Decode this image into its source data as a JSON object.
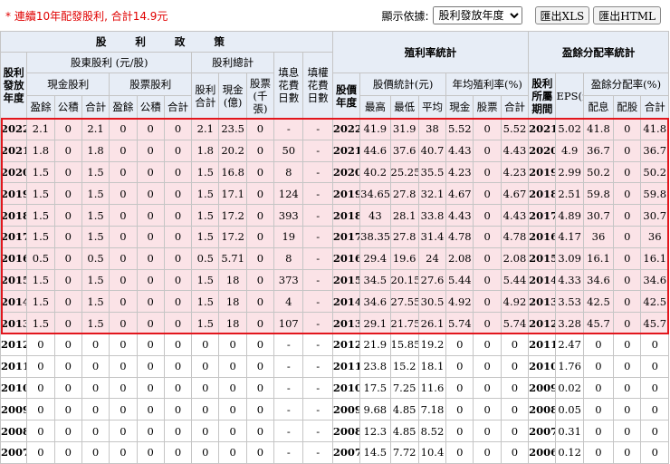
{
  "notice": "* 連續10年配發股利, 合計14.9元",
  "controls": {
    "filter_label": "顯示依據:",
    "filter_value": "股利發放年度",
    "export_xls": "匯出XLS",
    "export_html": "匯出HTML"
  },
  "headers": {
    "dividend_policy": "股 利 政 策",
    "dividend_year": "股利發放年度",
    "shareholder_dividend": "股東股利 (元/股)",
    "total_dividend": "股利總計",
    "ex_div_days": "填息花費日數",
    "ex_right_days": "填權花費日數",
    "cash_dividend": "現金股利",
    "stock_dividend": "股票股利",
    "dividend_total": "股利合計",
    "cash_100m": "現金(億)",
    "stock_k": "股票(千張)",
    "earnings": "盈餘",
    "capital_reserve": "公積",
    "subtotal": "合計",
    "yield_stats": "殖利率統計",
    "stock_year": "股價年度",
    "price_stats": "股價統計(元)",
    "avg_yield": "年均殖利率(%)",
    "high": "最高",
    "low": "最低",
    "avg": "平均",
    "cash": "現金",
    "stock": "股票",
    "payout_stats": "盈餘分配率統計",
    "earnings_period": "股利所屬期間",
    "eps": "EPS(元)",
    "payout_ratio": "盈餘分配率(%)",
    "pay_cash": "配息",
    "pay_stock": "配股"
  },
  "rows": [
    [
      "2022",
      "2.1",
      "0",
      "2.1",
      "0",
      "0",
      "0",
      "2.1",
      "23.5",
      "0",
      "-",
      "-",
      "2022",
      "41.9",
      "31.9",
      "38",
      "5.52",
      "0",
      "5.52",
      "2021",
      "5.02",
      "41.8",
      "0",
      "41.8"
    ],
    [
      "2021",
      "1.8",
      "0",
      "1.8",
      "0",
      "0",
      "0",
      "1.8",
      "20.2",
      "0",
      "50",
      "-",
      "2021",
      "44.6",
      "37.6",
      "40.7",
      "4.43",
      "0",
      "4.43",
      "2020",
      "4.9",
      "36.7",
      "0",
      "36.7"
    ],
    [
      "2020",
      "1.5",
      "0",
      "1.5",
      "0",
      "0",
      "0",
      "1.5",
      "16.8",
      "0",
      "8",
      "-",
      "2020",
      "40.2",
      "25.25",
      "35.5",
      "4.23",
      "0",
      "4.23",
      "2019",
      "2.99",
      "50.2",
      "0",
      "50.2"
    ],
    [
      "2019",
      "1.5",
      "0",
      "1.5",
      "0",
      "0",
      "0",
      "1.5",
      "17.1",
      "0",
      "124",
      "-",
      "2019",
      "34.65",
      "27.8",
      "32.1",
      "4.67",
      "0",
      "4.67",
      "2018",
      "2.51",
      "59.8",
      "0",
      "59.8"
    ],
    [
      "2018",
      "1.5",
      "0",
      "1.5",
      "0",
      "0",
      "0",
      "1.5",
      "17.2",
      "0",
      "393",
      "-",
      "2018",
      "43",
      "28.1",
      "33.8",
      "4.43",
      "0",
      "4.43",
      "2017",
      "4.89",
      "30.7",
      "0",
      "30.7"
    ],
    [
      "2017",
      "1.5",
      "0",
      "1.5",
      "0",
      "0",
      "0",
      "1.5",
      "17.2",
      "0",
      "19",
      "-",
      "2017",
      "38.35",
      "27.8",
      "31.4",
      "4.78",
      "0",
      "4.78",
      "2016",
      "4.17",
      "36",
      "0",
      "36"
    ],
    [
      "2016",
      "0.5",
      "0",
      "0.5",
      "0",
      "0",
      "0",
      "0.5",
      "5.71",
      "0",
      "8",
      "-",
      "2016",
      "29.4",
      "19.6",
      "24",
      "2.08",
      "0",
      "2.08",
      "2015",
      "3.09",
      "16.1",
      "0",
      "16.1"
    ],
    [
      "2015",
      "1.5",
      "0",
      "1.5",
      "0",
      "0",
      "0",
      "1.5",
      "18",
      "0",
      "373",
      "-",
      "2015",
      "34.5",
      "20.15",
      "27.6",
      "5.44",
      "0",
      "5.44",
      "2014",
      "4.33",
      "34.6",
      "0",
      "34.6"
    ],
    [
      "2014",
      "1.5",
      "0",
      "1.5",
      "0",
      "0",
      "0",
      "1.5",
      "18",
      "0",
      "4",
      "-",
      "2014",
      "34.6",
      "27.55",
      "30.5",
      "4.92",
      "0",
      "4.92",
      "2013",
      "3.53",
      "42.5",
      "0",
      "42.5"
    ],
    [
      "2013",
      "1.5",
      "0",
      "1.5",
      "0",
      "0",
      "0",
      "1.5",
      "18",
      "0",
      "107",
      "-",
      "2013",
      "29.1",
      "21.75",
      "26.1",
      "5.74",
      "0",
      "5.74",
      "2012",
      "3.28",
      "45.7",
      "0",
      "45.7"
    ],
    [
      "2012",
      "0",
      "0",
      "0",
      "0",
      "0",
      "0",
      "0",
      "0",
      "0",
      "-",
      "-",
      "2012",
      "21.9",
      "15.85",
      "19.2",
      "0",
      "0",
      "0",
      "2011",
      "2.47",
      "0",
      "0",
      "0"
    ],
    [
      "2011",
      "0",
      "0",
      "0",
      "0",
      "0",
      "0",
      "0",
      "0",
      "0",
      "-",
      "-",
      "2011",
      "23.8",
      "15.2",
      "18.1",
      "0",
      "0",
      "0",
      "2010",
      "1.76",
      "0",
      "0",
      "0"
    ],
    [
      "2010",
      "0",
      "0",
      "0",
      "0",
      "0",
      "0",
      "0",
      "0",
      "0",
      "-",
      "-",
      "2010",
      "17.5",
      "7.25",
      "11.6",
      "0",
      "0",
      "0",
      "2009",
      "0.02",
      "0",
      "0",
      "0"
    ],
    [
      "2009",
      "0",
      "0",
      "0",
      "0",
      "0",
      "0",
      "0",
      "0",
      "0",
      "-",
      "-",
      "2009",
      "9.68",
      "4.85",
      "7.18",
      "0",
      "0",
      "0",
      "2008",
      "0.05",
      "0",
      "0",
      "0"
    ],
    [
      "2008",
      "0",
      "0",
      "0",
      "0",
      "0",
      "0",
      "0",
      "0",
      "0",
      "-",
      "-",
      "2008",
      "12.3",
      "4.85",
      "8.52",
      "0",
      "0",
      "0",
      "2007",
      "0.31",
      "0",
      "0",
      "0"
    ],
    [
      "2007",
      "0",
      "0",
      "0",
      "0",
      "0",
      "0",
      "0",
      "0",
      "0",
      "-",
      "-",
      "2007",
      "14.5",
      "7.72",
      "10.4",
      "0",
      "0",
      "0",
      "2006",
      "0.12",
      "0",
      "0",
      "0"
    ]
  ],
  "highlight_rows": 10,
  "colors": {
    "highlight": "#fbe3e7",
    "header": "#e7edf6",
    "accent_red": "#e2161d"
  }
}
